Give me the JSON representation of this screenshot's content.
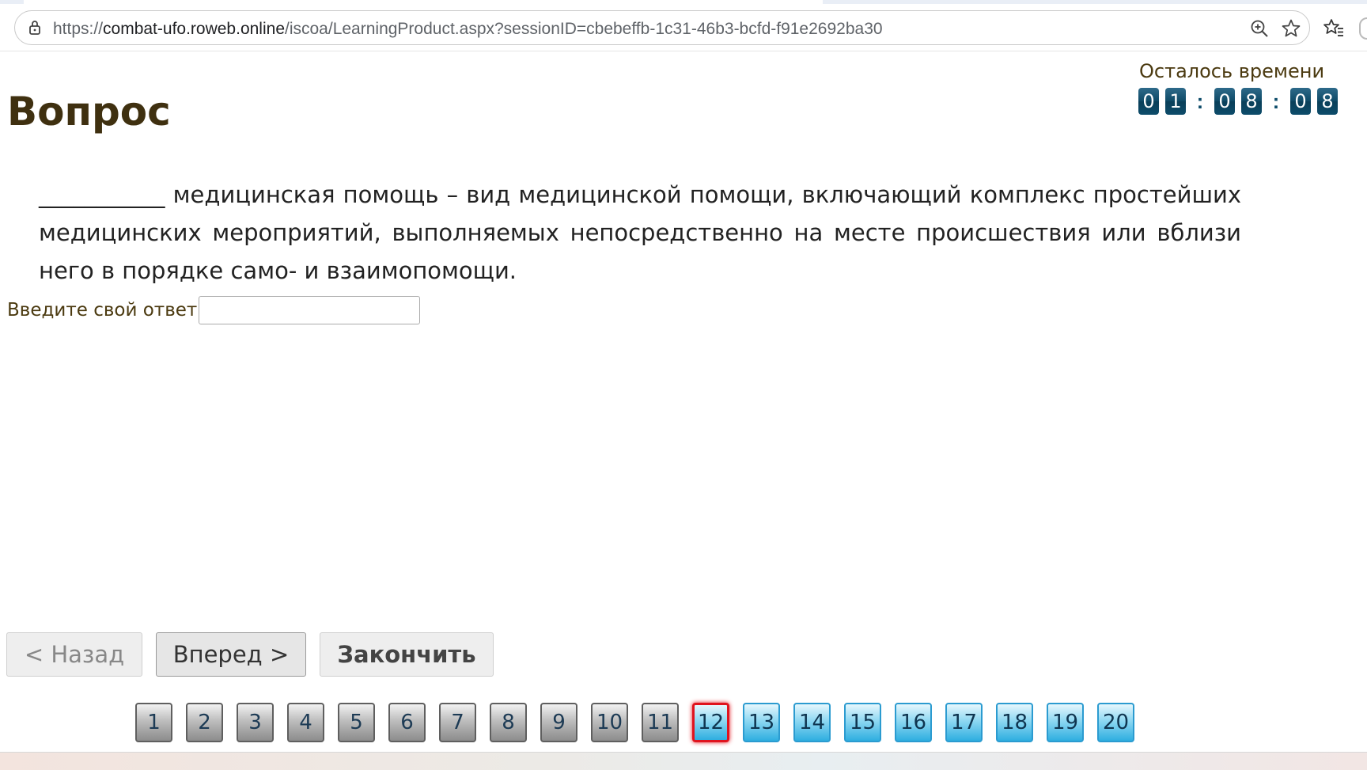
{
  "browser": {
    "url_prefix": "https://",
    "url_host": "combat-ufo.roweb.online",
    "url_path": "/iscoa/LearningProduct.aspx?sessionID=cbebeffb-1c31-46b3-bcfd-f91e2692ba30"
  },
  "page": {
    "title": "Вопрос"
  },
  "timer": {
    "label": "Осталось времени",
    "digits": [
      "0",
      "1",
      "0",
      "8",
      "0",
      "8"
    ],
    "separator": ":"
  },
  "question": {
    "text": "___________ медицинская помощь – вид медицинской помощи, включающий комплекс простейших медицинских мероприятий, выполняемых непосредственно на месте происшествия или вблизи него в порядке само- и взаимопомощи."
  },
  "answer": {
    "label": "Введите свой ответ",
    "value": ""
  },
  "navigation": {
    "back_label": "< Назад",
    "next_label": "Вперед >",
    "finish_label": "Закончить"
  },
  "pager": {
    "current": 12,
    "pages": [
      "1",
      "2",
      "3",
      "4",
      "5",
      "6",
      "7",
      "8",
      "9",
      "10",
      "11",
      "12",
      "13",
      "14",
      "15",
      "16",
      "17",
      "18",
      "19",
      "20"
    ]
  },
  "colors": {
    "title": "#3f3010",
    "timer_digit_bg": "#0d4c6a",
    "current_page_border": "#e0141e",
    "answered_page": "#8c8c8c",
    "unanswered_page": "#2eaee0"
  }
}
